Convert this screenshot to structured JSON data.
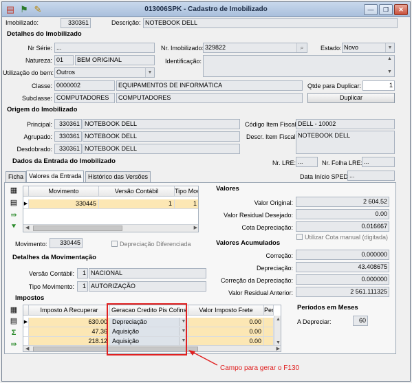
{
  "window": {
    "title": "013006SPK - Cadastro de Imobilizado",
    "minimize": "—",
    "restore": "❐",
    "close": "✕"
  },
  "header": {
    "imobilizado_label": "Imobilizado:",
    "imobilizado_value": "330361",
    "descricao_label": "Descrição:",
    "descricao_value": "NOTEBOOK DELL"
  },
  "detalhes": {
    "title": "Detalhes do Imobilizado",
    "nr_serie_label": "Nr Série:",
    "nr_serie_value": "...",
    "nr_imobilizado_label": "Nr. Imobilizado:",
    "nr_imobilizado_value": "329822",
    "estado_label": "Estado:",
    "estado_value": "Novo",
    "natureza_label": "Natureza:",
    "natureza_code": "01",
    "natureza_desc": "BEM ORIGINAL",
    "identificacao_label": "Identificação:",
    "identificacao_value": "",
    "utilizacao_label": "Utilização do bem:",
    "utilizacao_value": "Outros",
    "classe_label": "Classe:",
    "classe_code": "0000002",
    "classe_desc": "EQUIPAMENTOS DE INFORMÁTICA",
    "qtde_label": "Qtde para Duplicar:",
    "qtde_value": "1",
    "subclasse_label": "Subclasse:",
    "subclasse_code": "COMPUTADORES",
    "subclasse_desc": "COMPUTADORES",
    "duplicar_button": "Duplicar"
  },
  "origem": {
    "title": "Origem do Imobilizado",
    "principal_label": "Principal:",
    "principal_code": "330361",
    "principal_desc": "NOTEBOOK DELL",
    "agrupado_label": "Agrupado:",
    "agrupado_code": "330361",
    "agrupado_desc": "NOTEBOOK DELL",
    "desdobrado_label": "Desdobrado:",
    "desdobrado_code": "330361",
    "desdobrado_desc": "NOTEBOOK DELL",
    "codigo_fiscal_label": "Código Item Fiscal:",
    "codigo_fiscal_value": "DELL - 10002",
    "descr_fiscal_label": "Descr. Item Fiscal:",
    "descr_fiscal_value": "NOTEBOOK DELL"
  },
  "entrada": {
    "title": "Dados da Entrada do Imobilizado",
    "nr_lre_label": "Nr. LRE:",
    "nr_lre_value": "...",
    "nr_folha_label": "Nr. Folha LRE:",
    "nr_folha_value": "...",
    "data_sped_label": "Data Início SPED:",
    "data_sped_value": "...",
    "tabs": [
      "Ficha",
      "Valores da Entrada",
      "Histórico das Versões"
    ]
  },
  "mov_grid": {
    "columns": [
      "Movimento",
      "Versão Contábil",
      "Tipo Movimento"
    ],
    "rows": [
      [
        "330445",
        "1",
        "1"
      ]
    ]
  },
  "movimento": {
    "label": "Movimento:",
    "value": "330445",
    "depreciacao_diferenciada": "Depreciação Diferenciada"
  },
  "detalhes_mov": {
    "title": "Detalhes da Movimentação",
    "versao_label": "Versão Contábil:",
    "versao_code": "1",
    "versao_desc": "NACIONAL",
    "tipo_label": "Tipo Movimento:",
    "tipo_code": "1",
    "tipo_desc": "AUTORIZAÇÃO"
  },
  "valores": {
    "title": "Valores",
    "original_label": "Valor Original:",
    "original_value": "2 604.52",
    "residual_desejado_label": "Valor Residual Desejado:",
    "residual_desejado_value": "0.00",
    "cota_label": "Cota Depreciação:",
    "cota_value": "0.016667",
    "cota_manual_label": "Utilizar Cota manual (digitada)"
  },
  "acumulados": {
    "title": "Valores Acumulados",
    "correcao_label": "Correção:",
    "correcao_value": "0.000000",
    "depreciacao_label": "Depreciação:",
    "depreciacao_value": "43.408675",
    "correcao_dep_label": "Correção da Depreciação:",
    "correcao_dep_value": "0.000000",
    "residual_anterior_label": "Valor Residual Anterior:",
    "residual_anterior_value": "2 561.111325"
  },
  "periodos": {
    "title": "Períodos em Meses",
    "depreciar_label": "A Depreciar:",
    "depreciar_value": "60"
  },
  "impostos": {
    "title": "Impostos",
    "columns": [
      "Imposto A Recuperar",
      "Geracao Credito Pis Cofins",
      "Valor Imposto Frete",
      "Per"
    ],
    "rows": [
      [
        "630.00",
        "Depreciação",
        "0.00"
      ],
      [
        "47.36",
        "Aquisição",
        "0.00"
      ],
      [
        "218.12",
        "Aquisição",
        "0.00"
      ]
    ]
  },
  "annotation": {
    "text": "Campo para gerar o F130",
    "color": "#e02020"
  },
  "colors": {
    "selected_row": "#fce7b4",
    "title_text": "#1a2a44",
    "annotation_red": "#e02020"
  }
}
